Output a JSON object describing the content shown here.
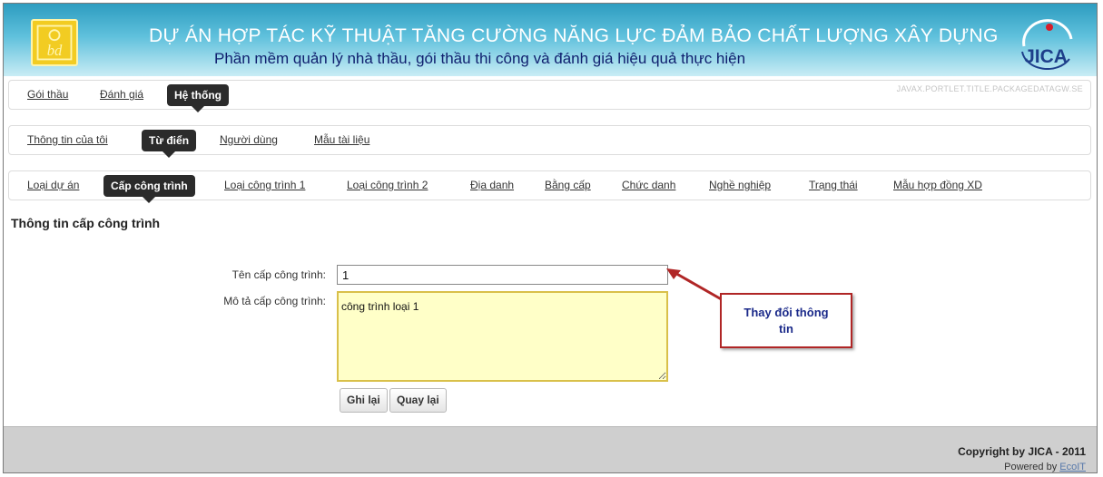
{
  "header": {
    "title": "DỰ ÁN HỢP TÁC KỸ THUẬT TĂNG CƯỜNG NĂNG LỰC ĐẢM BẢO CHẤT LƯỢNG XÂY DỰNG",
    "subtitle": "Phần mềm quản lý nhà thầu, gói thầu thi công và đánh giá hiệu quả thực hiện",
    "logo_left_text": "bd",
    "logo_right_text": "JICA"
  },
  "nav_main": {
    "items": [
      "Gói thầu",
      "Đánh giá",
      "Hệ thống"
    ],
    "active": "Hệ thống",
    "portlet_id": "JAVAX.PORTLET.TITLE.PACKAGEDATAGW.SE"
  },
  "nav_system": {
    "items": [
      "Thông tin của tôi",
      "Từ điển",
      "Người dùng",
      "Mẫu tài liệu"
    ],
    "active": "Từ điển"
  },
  "nav_dictionary": {
    "items": [
      "Loại dự án",
      "Cấp công trình",
      "Loại công trình 1",
      "Loại công trình 2",
      "Địa danh",
      "Bằng cấp",
      "Chức danh",
      "Nghề nghiệp",
      "Trạng thái",
      "Mẫu hợp đồng XD"
    ],
    "active": "Cấp công trình"
  },
  "form": {
    "section_title": "Thông tin cấp công trình",
    "name_label": "Tên cấp công trình:",
    "name_value": "1",
    "desc_label": "Mô tả cấp công trình:",
    "desc_value": "công trình loại 1",
    "save_label": "Ghi lại",
    "back_label": "Quay lại"
  },
  "callout": {
    "line1": "Thay đổi thông",
    "line2": "tin",
    "border_color": "#b02626"
  },
  "footer": {
    "copyright": "Copyright by JICA - 2011",
    "powered_prefix": "Powered by ",
    "powered_link": "EcoIT"
  },
  "colors": {
    "active_tab": "#2b2b2b",
    "banner": "#5fc0dc",
    "textarea_bg": "#ffffc8"
  }
}
